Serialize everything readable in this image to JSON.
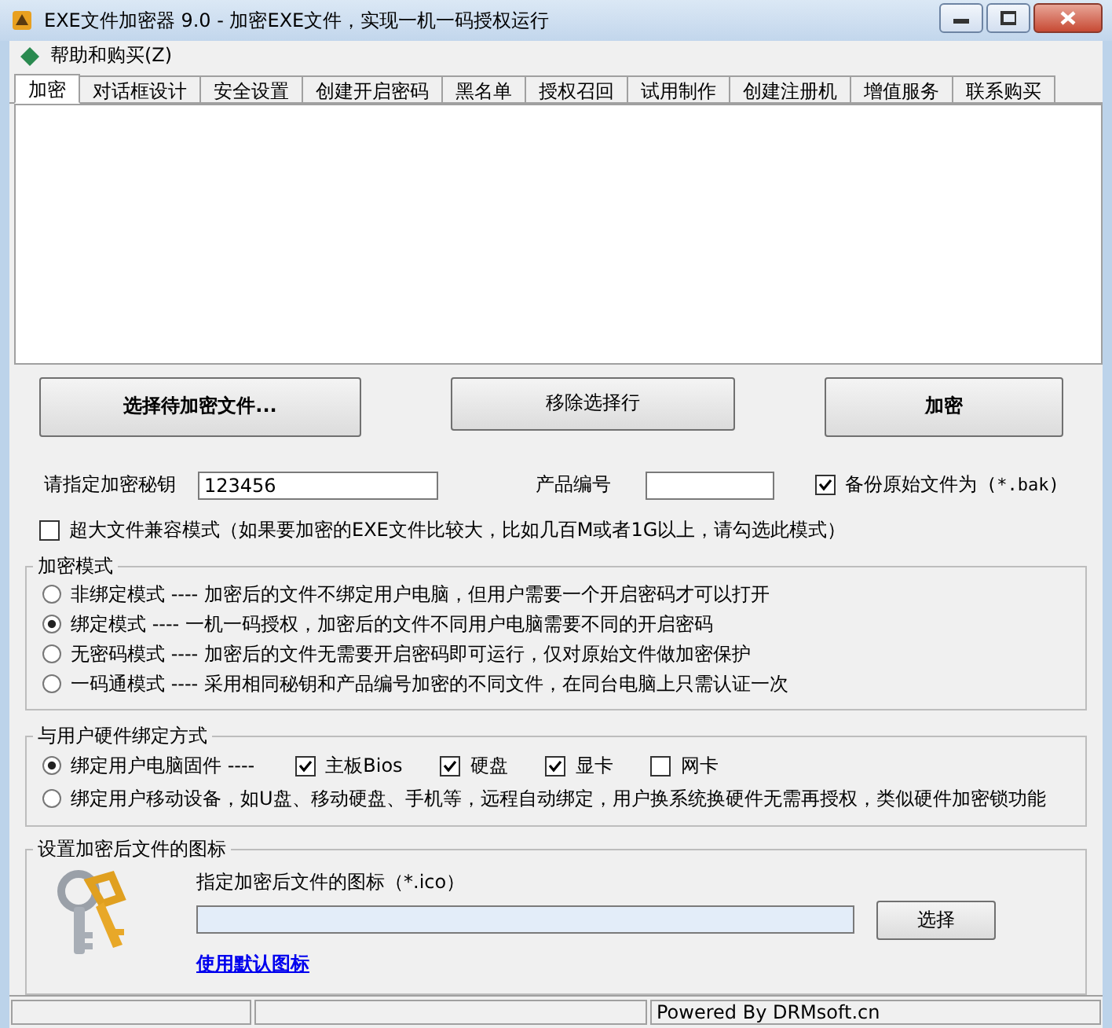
{
  "window": {
    "title": "EXE文件加密器 9.0 - 加密EXE文件，实现一机一码授权运行"
  },
  "menu": [
    {
      "label": "帮助和购买(Z)"
    }
  ],
  "tabs": [
    {
      "label": "加密",
      "selected": true
    },
    {
      "label": "对话框设计",
      "selected": false
    },
    {
      "label": "安全设置",
      "selected": false
    },
    {
      "label": "创建开启密码",
      "selected": false
    },
    {
      "label": "黑名单",
      "selected": false
    },
    {
      "label": "授权召回",
      "selected": false
    },
    {
      "label": "试用制作",
      "selected": false
    },
    {
      "label": "创建注册机",
      "selected": false
    },
    {
      "label": "增值服务",
      "selected": false
    },
    {
      "label": "联系购买",
      "selected": false
    }
  ],
  "buttons": [
    {
      "label": "选择待加密文件...",
      "bold": true
    },
    {
      "label": "移除选择行",
      "bold": false
    },
    {
      "label": "加密",
      "bold": true
    }
  ],
  "key_field": {
    "label": "请指定加密秘钥",
    "value": "123456"
  },
  "product_field": {
    "label": "产品编号"
  },
  "backup": {
    "label": "备份原始文件为",
    "hint": "(*.bak)",
    "checked": true
  },
  "large_file": {
    "label": "超大文件兼容模式（如果要加密的EXE文件比较大，比如几百M或者1G以上，请勾选此模式）",
    "checked": false
  },
  "encrypt_mode": {
    "title": "加密模式",
    "options": [
      {
        "label": "非绑定模式 ---- 加密后的文件不绑定用户电脑，但用户需要一个开启密码才可以打开",
        "selected": false
      },
      {
        "label": "绑定模式 ---- 一机一码授权，加密后的文件不同用户电脑需要不同的开启密码",
        "selected": true
      },
      {
        "label": "无密码模式 ---- 加密后的文件无需要开启密码即可运行，仅对原始文件做加密保护",
        "selected": false
      },
      {
        "label": "一码通模式 ---- 采用相同秘钥和产品编号加密的不同文件，在同台电脑上只需认证一次",
        "selected": false
      }
    ]
  },
  "hardware_binding": {
    "title": "与用户硬件绑定方式",
    "options": [
      {
        "label": "绑定用户电脑固件 ----",
        "selected": true,
        "components": [
          {
            "label": "主板Bios",
            "checked": true
          },
          {
            "label": "硬盘",
            "checked": true
          },
          {
            "label": "显卡",
            "checked": true
          },
          {
            "label": "网卡",
            "checked": false
          }
        ]
      },
      {
        "label": "绑定用户移动设备，如U盘、移动硬盘、手机等，远程自动绑定，用户换系统换硬件无需再授权，类似硬件加密锁功能",
        "selected": false
      }
    ]
  },
  "icon_setting": {
    "title": "设置加密后文件的图标",
    "field_label": "指定加密后文件的图标（*.ico）",
    "browse_button": "选择",
    "default_link": "使用默认图标"
  },
  "status_bar": {
    "text": "Powered By DRMsoft.cn"
  }
}
